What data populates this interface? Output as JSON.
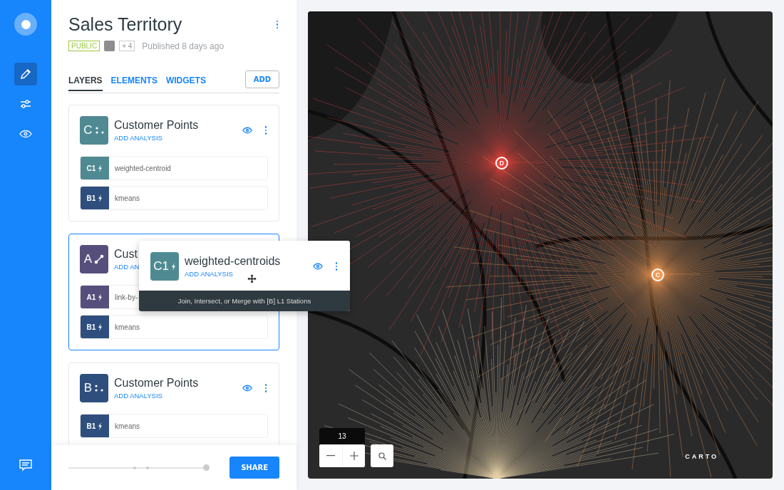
{
  "sidebar": {
    "items": [
      {
        "kind": "edit",
        "selected": true
      },
      {
        "kind": "filters",
        "selected": false
      },
      {
        "kind": "preview",
        "selected": false
      }
    ]
  },
  "header": {
    "title": "Sales Territory",
    "visibility": "PUBLIC",
    "collaborators_more": "+ 4",
    "published": "Published 8 days ago"
  },
  "tabs": [
    {
      "label": "LAYERS",
      "selected": true
    },
    {
      "label": "ELEMENTS",
      "selected": false
    },
    {
      "label": "WIDGETS",
      "selected": false
    }
  ],
  "add_button": "ADD",
  "layers": [
    {
      "letter": "C",
      "color": "#4f8a93",
      "kind": "points",
      "title": "Customer Points",
      "add_analysis": "ADD ANALYSIS",
      "selected": false,
      "show_actions": true,
      "analyses": [
        {
          "id": "C1",
          "color": "#4f8a93",
          "name": "weighted-centroid"
        },
        {
          "id": "B1",
          "color": "#2e4f7e",
          "name": "kmeans"
        }
      ]
    },
    {
      "letter": "A",
      "color": "#574f7b",
      "kind": "line",
      "title": "Cust",
      "add_analysis": "ADD AN",
      "selected": true,
      "show_actions": false,
      "analyses": [
        {
          "id": "A1",
          "color": "#574f7b",
          "name": "link-by-"
        },
        {
          "id": "B1",
          "color": "#2e4f7e",
          "name": "kmeans"
        }
      ]
    },
    {
      "letter": "B",
      "color": "#2e4f7e",
      "kind": "points",
      "title": "Customer Points",
      "add_analysis": "ADD ANALYSIS",
      "selected": false,
      "show_actions": true,
      "analyses": [
        {
          "id": "B1",
          "color": "#2e4f7e",
          "name": "kmeans"
        }
      ]
    }
  ],
  "drag_preview": {
    "id": "C1",
    "color": "#4f8a93",
    "title": "weighted-centroids",
    "add_analysis": "ADD ANALYSIS",
    "hint": "Join, Intersect, or Merge with [B] L1 Stations"
  },
  "map": {
    "markers": [
      {
        "label": "D",
        "color": "#e8453c"
      },
      {
        "label": "C",
        "color": "#f29a55"
      }
    ],
    "zoom": "13",
    "attribution": "CARTO"
  },
  "footer": {
    "timeline": {
      "level": 1
    },
    "share": "SHARE"
  }
}
